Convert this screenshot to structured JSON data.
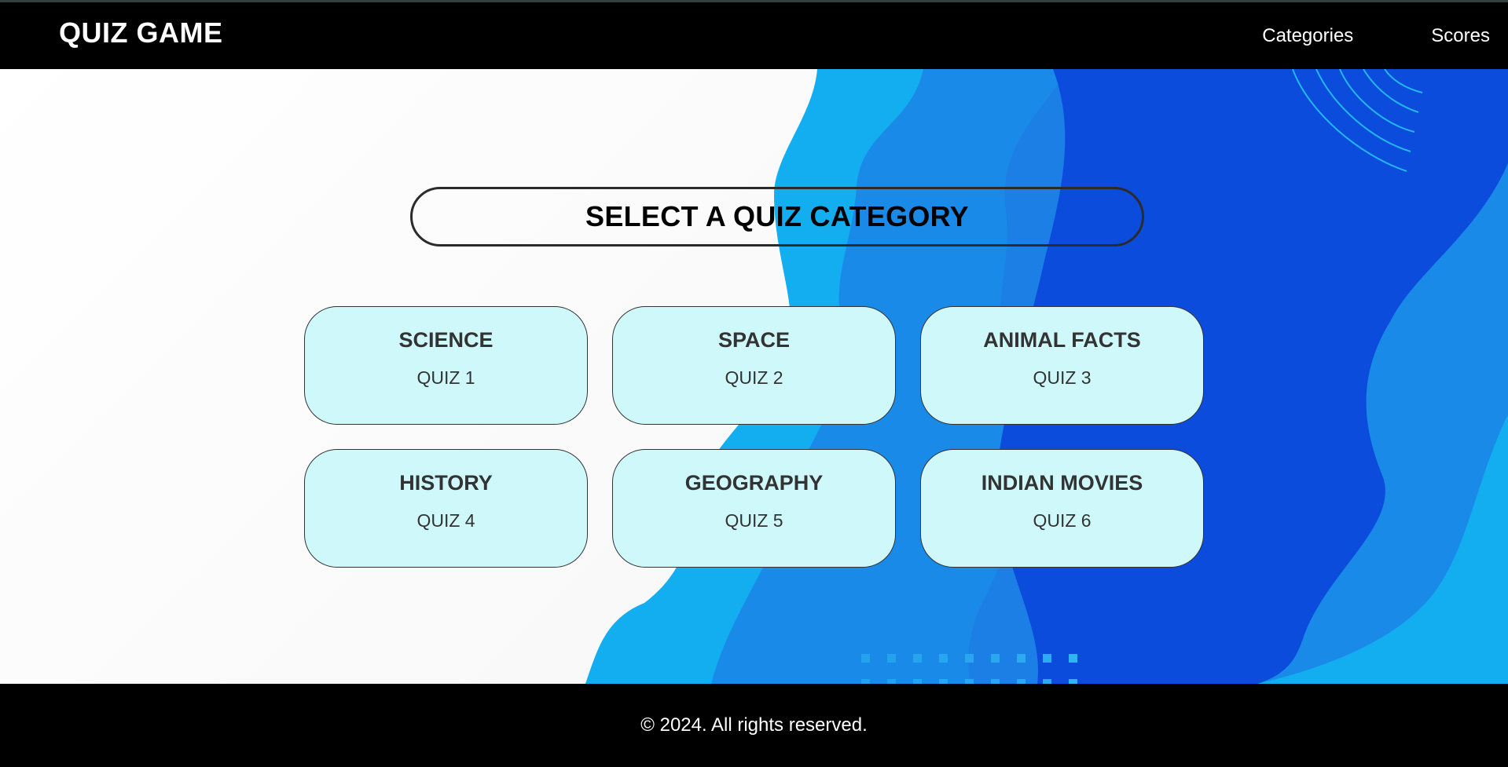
{
  "header": {
    "brand": "QUIZ GAME",
    "nav": {
      "categories": "Categories",
      "scores": "Scores"
    }
  },
  "main": {
    "title": "SELECT A QUIZ CATEGORY",
    "categories": [
      {
        "name": "SCIENCE",
        "quiz": "QUIZ 1"
      },
      {
        "name": "SPACE",
        "quiz": "QUIZ 2"
      },
      {
        "name": "ANIMAL FACTS",
        "quiz": "QUIZ 3"
      },
      {
        "name": "HISTORY",
        "quiz": "QUIZ 4"
      },
      {
        "name": "GEOGRAPHY",
        "quiz": "QUIZ 5"
      },
      {
        "name": "INDIAN MOVIES",
        "quiz": "QUIZ 6"
      }
    ]
  },
  "footer": {
    "copyright": "© 2024. All rights reserved."
  },
  "colors": {
    "header_bg": "#000000",
    "card_bg": "#cff8fa",
    "wave_light": "#12aef0",
    "wave_mid": "#1a8ae8",
    "wave_deep": "#0b4cdd"
  }
}
